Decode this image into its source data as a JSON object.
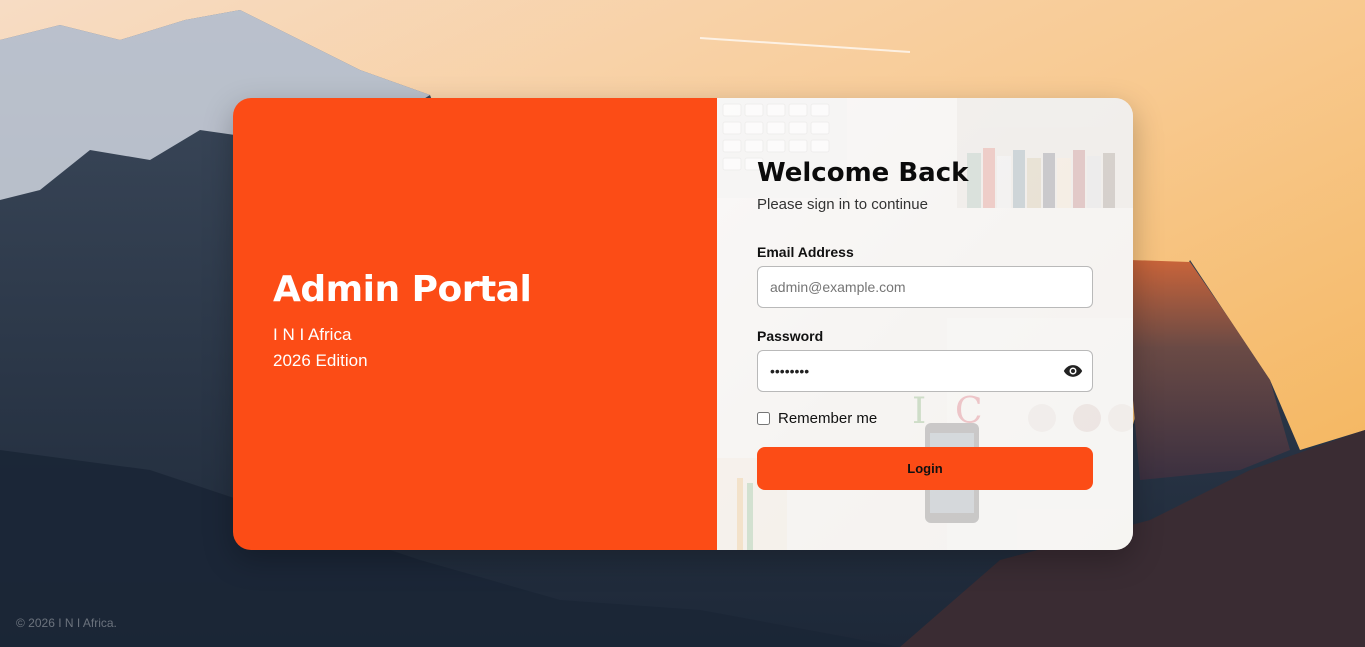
{
  "left_panel": {
    "title": "Admin Portal",
    "org": "I N I Africa",
    "edition": "2026 Edition",
    "color": "#fc4c16"
  },
  "form": {
    "heading": "Welcome Back",
    "subheading": "Please sign in to continue",
    "email": {
      "label": "Email Address",
      "placeholder": "admin@example.com",
      "value": ""
    },
    "password": {
      "label": "Password",
      "value": "••••••••",
      "toggle_icon": "eye-icon"
    },
    "remember": {
      "label": "Remember me",
      "checked": false
    },
    "login_label": "Login"
  },
  "footer": {
    "text": "© 2026 I N I Africa."
  }
}
